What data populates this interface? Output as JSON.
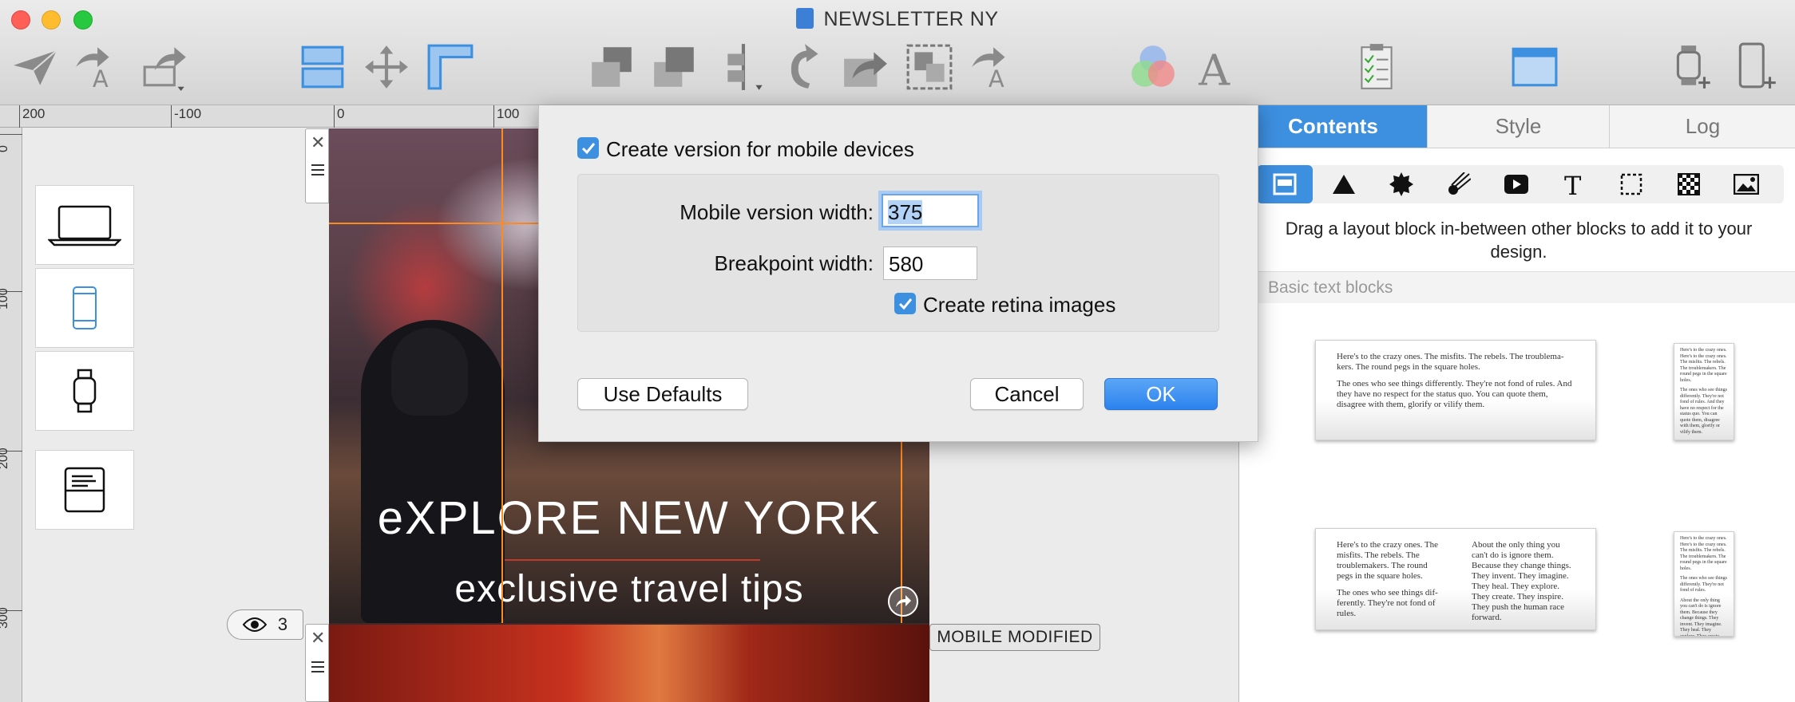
{
  "window": {
    "title": "NEWSLETTER NY"
  },
  "toolbar": {
    "icons": [
      "send-icon",
      "translate-icon",
      "share-icon",
      "layout-icon",
      "move-icon",
      "ruler-icon",
      "bring-front-icon",
      "send-back-icon",
      "align-icon",
      "rotate-icon",
      "forward-icon",
      "group-icon",
      "translate-icon",
      "colors-icon",
      "font-icon",
      "checklist-icon",
      "preview-window-icon",
      "add-watch-icon",
      "add-device-icon"
    ]
  },
  "rulers": {
    "top": [
      "200",
      "-100",
      "0",
      "100"
    ],
    "left": [
      "0",
      "100",
      "200",
      "300"
    ]
  },
  "devices": [
    "laptop-icon",
    "phone-icon",
    "watch-icon",
    "email-icon"
  ],
  "preview": {
    "headline": "eXPLORE NEW YORK",
    "subline": "exclusive travel tips",
    "view_count": "3",
    "mobile_badge": "MOBILE MODIFIED"
  },
  "dialog": {
    "create_mobile_label": "Create version for mobile devices",
    "create_mobile_checked": true,
    "mobile_width_label": "Mobile version width:",
    "mobile_width_value": "375",
    "breakpoint_label": "Breakpoint width:",
    "breakpoint_value": "580",
    "retina_label": "Create retina images",
    "retina_checked": true,
    "use_defaults": "Use Defaults",
    "cancel": "Cancel",
    "ok": "OK"
  },
  "panel": {
    "tabs": [
      "Contents",
      "Style",
      "Log"
    ],
    "active_tab": "Contents",
    "tools": [
      "layout-block-icon",
      "shape-icon",
      "badge-icon",
      "comet-icon",
      "video-icon",
      "text-icon",
      "selection-icon",
      "pattern-icon",
      "image-icon"
    ],
    "hint": "Drag a layout block in-between other blocks to add it to your design.",
    "section": "Basic text blocks",
    "card1": {
      "p1": "Here's to the crazy ones. The misfits. The rebels. The troublema-kers. The round pegs in the square holes.",
      "p2": "The ones who see things differently. They're not fond of rules. And they have no respect for the status quo. You can quote them, disagree with them, glorify or vilify them."
    },
    "card1s": {
      "p1": "Here's to the crazy ones. Here's to the crazy ones. The misfits. The rebels. The troublemakers. The round pegs in the square holes.",
      "p2": "The ones who see things differently. They're not fond of rules. And they have no respect for the status quo. You can quote them, disagree with them, glorify or vilify them."
    },
    "card2": {
      "c1p1": "Here's to the crazy ones. The misfits. The rebels. The troublemakers. The round pegs in the square holes.",
      "c1p2": "The ones who see things dif-ferently. They're not fond of rules.",
      "c2": "About the only thing you can't do is ignore them. Because they change things. They invent. They imagine. They heal. They explore. They create. They inspire. They push the human race forward."
    },
    "card2s": {
      "p1": "Here's to the crazy ones. Here's to the crazy ones. The misfits. The rebels. The troublemakers. The round pegs in the square holes.",
      "p2": "The ones who see things differently. They're not fond of rules.",
      "p3": "About the only thing you can't do is ignore them. Because they change things. They invent. They imagine. They heal. They explore. They create. They inspire. They tee"
    }
  }
}
